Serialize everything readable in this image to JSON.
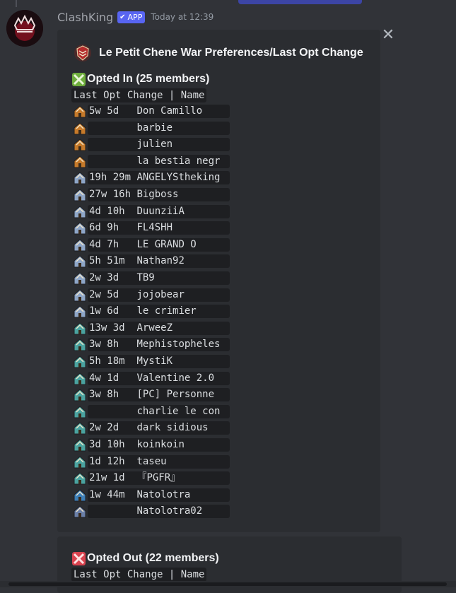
{
  "message": {
    "username": "ClashKing",
    "badge": "APP",
    "timestamp": "Today at 12:39"
  },
  "embed": {
    "title": "Le Petit Chene War Preferences/Last Opt Change",
    "opted_in_header": "Opted In (25 members)",
    "opted_out_header": "Opted Out (22 members)",
    "column_header": "Last Opt Change | Name",
    "members": [
      {
        "time": "5w 5d  ",
        "name": "Don Camillo",
        "th": 14
      },
      {
        "time": "       ",
        "name": "barbie",
        "th": 14
      },
      {
        "time": "       ",
        "name": "julien",
        "th": 14
      },
      {
        "time": "       ",
        "name": "la bestia negr",
        "th": 14
      },
      {
        "time": "19h 29m",
        "name": "ANGELYStheking",
        "th": 13
      },
      {
        "time": "27w 16h",
        "name": "Bigboss",
        "th": 13
      },
      {
        "time": "4d 10h ",
        "name": "DuunziiA",
        "th": 13
      },
      {
        "time": "6d 9h  ",
        "name": "FL4SHH",
        "th": 13
      },
      {
        "time": "4d 7h  ",
        "name": "LE GRAND O",
        "th": 13
      },
      {
        "time": "5h 51m ",
        "name": "Nathan92",
        "th": 13
      },
      {
        "time": "2w 3d  ",
        "name": "TB9",
        "th": 13
      },
      {
        "time": "2w 5d  ",
        "name": "jojobear",
        "th": 13
      },
      {
        "time": "1w 6d  ",
        "name": "le crimier",
        "th": 13
      },
      {
        "time": "13w 3d ",
        "name": "ArweeZ",
        "th": 12
      },
      {
        "time": "3w 8h  ",
        "name": "Mephistopheles",
        "th": 12
      },
      {
        "time": "5h 18m ",
        "name": "MystiK",
        "th": 12
      },
      {
        "time": "4w 1d  ",
        "name": "Valentine 2.0",
        "th": 12
      },
      {
        "time": "3w 8h  ",
        "name": "[PC] Personne",
        "th": 12
      },
      {
        "time": "       ",
        "name": "charlie le con",
        "th": 12
      },
      {
        "time": "2w 2d  ",
        "name": "dark sidious",
        "th": 12
      },
      {
        "time": "3d 10h ",
        "name": "koinkoin",
        "th": 12
      },
      {
        "time": "1d 12h ",
        "name": "taseu",
        "th": 12
      },
      {
        "time": "21w 1d ",
        "name": "『PGFR』",
        "th": 12
      },
      {
        "time": "1w 44m ",
        "name": "Natolotra",
        "th": 11
      },
      {
        "time": "       ",
        "name": "Natolotra02",
        "th": 10
      }
    ]
  },
  "colors": {
    "background": "#313338",
    "embed": "#2b2d31",
    "code": "#1e1f22",
    "badge": "#5865f2",
    "th14": "#c67a2a",
    "th13": "#8ea6c8",
    "th12": "#4aa3a0",
    "th11": "#3d7fb8",
    "th10": "#6a7fa8"
  },
  "icons": {
    "avatar": "crown-avatar-icon",
    "close": "close-icon",
    "title": "war-shield-icon",
    "opted_in": "green-crossed-swords-icon",
    "opted_out": "red-crossed-swords-icon"
  }
}
